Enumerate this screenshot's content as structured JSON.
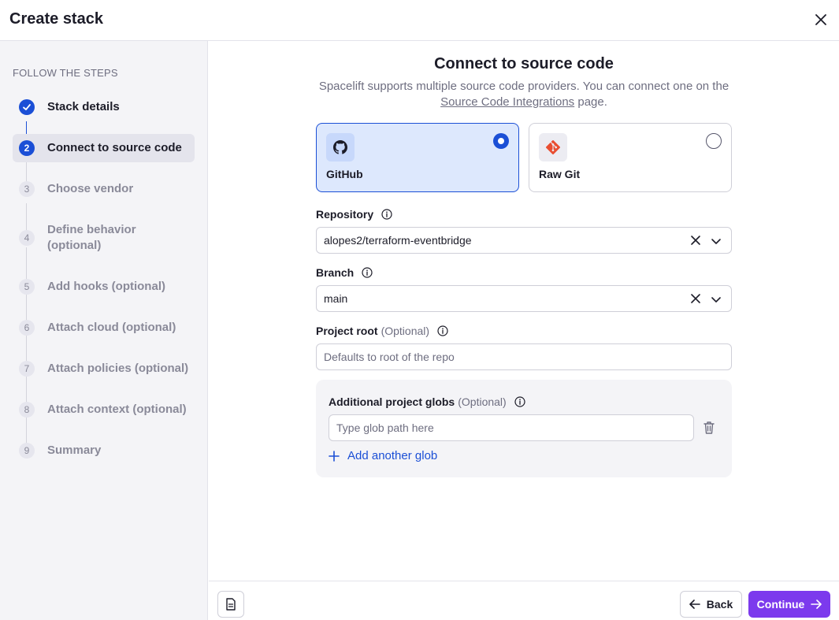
{
  "header": {
    "title": "Create stack",
    "close_icon": "close-icon"
  },
  "sidebar": {
    "heading": "FOLLOW THE STEPS",
    "steps": [
      {
        "badge": "",
        "label": "Stack details",
        "state": "done"
      },
      {
        "badge": "2",
        "label": "Connect to source code",
        "state": "current"
      },
      {
        "badge": "3",
        "label": "Choose vendor",
        "state": "pending"
      },
      {
        "badge": "4",
        "label": "Define behavior (optional)",
        "state": "pending"
      },
      {
        "badge": "5",
        "label": "Add hooks (optional)",
        "state": "pending"
      },
      {
        "badge": "6",
        "label": "Attach cloud (optional)",
        "state": "pending"
      },
      {
        "badge": "7",
        "label": "Attach policies (optional)",
        "state": "pending"
      },
      {
        "badge": "8",
        "label": "Attach context (optional)",
        "state": "pending"
      },
      {
        "badge": "9",
        "label": "Summary",
        "state": "pending"
      }
    ]
  },
  "main": {
    "title": "Connect to source code",
    "subtitle_pre": "Spacelift supports multiple source code providers. You can connect one on the",
    "subtitle_link": "Source Code Integrations",
    "subtitle_post": "page.",
    "providers": [
      {
        "name": "GitHub",
        "icon": "github-icon",
        "selected": true
      },
      {
        "name": "Raw Git",
        "icon": "git-icon",
        "selected": false
      }
    ],
    "repository": {
      "label": "Repository",
      "value": "alopes2/terraform-eventbridge"
    },
    "branch": {
      "label": "Branch",
      "value": "main"
    },
    "project_root": {
      "label": "Project root",
      "optional": "(Optional)",
      "placeholder": "Defaults to root of the repo"
    },
    "globs": {
      "label": "Additional project globs",
      "optional": "(Optional)",
      "placeholder": "Type glob path here",
      "add_label": "Add another glob"
    }
  },
  "footer": {
    "back_label": "Back",
    "continue_label": "Continue"
  },
  "colors": {
    "accent": "#1b4fd6",
    "primary_button": "#7c3aed",
    "selected_card": "#dde8fd"
  }
}
